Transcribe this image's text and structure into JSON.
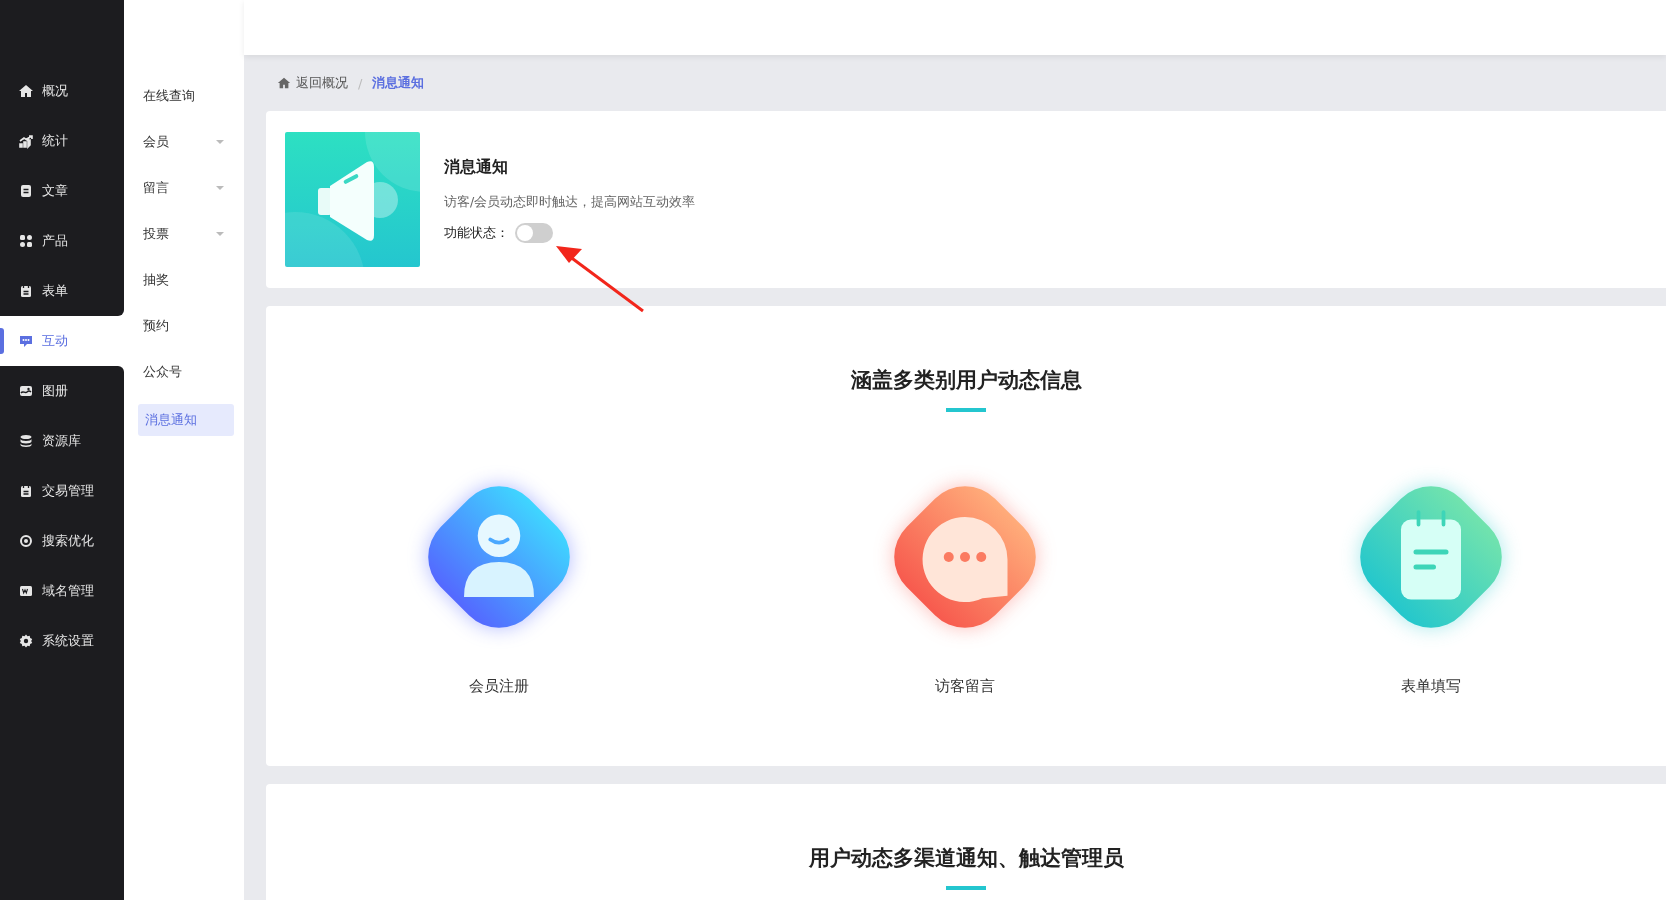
{
  "sidebar": {
    "items": [
      {
        "label": "概况",
        "selected": false
      },
      {
        "label": "统计",
        "selected": false
      },
      {
        "label": "文章",
        "selected": false
      },
      {
        "label": "产品",
        "selected": false
      },
      {
        "label": "表单",
        "selected": false
      },
      {
        "label": "互动",
        "selected": true
      },
      {
        "label": "图册",
        "selected": false
      },
      {
        "label": "资源库",
        "selected": false
      },
      {
        "label": "交易管理",
        "selected": false
      },
      {
        "label": "搜索优化",
        "selected": false
      },
      {
        "label": "域名管理",
        "selected": false
      },
      {
        "label": "系统设置",
        "selected": false
      }
    ]
  },
  "submenu": {
    "items": [
      {
        "label": "在线查询",
        "expandable": false,
        "selected": false
      },
      {
        "label": "会员",
        "expandable": true,
        "selected": false
      },
      {
        "label": "留言",
        "expandable": true,
        "selected": false
      },
      {
        "label": "投票",
        "expandable": true,
        "selected": false
      },
      {
        "label": "抽奖",
        "expandable": false,
        "selected": false
      },
      {
        "label": "预约",
        "expandable": false,
        "selected": false
      },
      {
        "label": "公众号",
        "expandable": false,
        "selected": false
      },
      {
        "label": "消息通知",
        "expandable": false,
        "selected": true
      }
    ]
  },
  "breadcrumb": {
    "back": "返回概况",
    "separator": "/",
    "current": "消息通知"
  },
  "feature_card": {
    "title": "消息通知",
    "description": "访客/会员动态即时触达，提高网站互动效率",
    "status_label": "功能状态：",
    "toggle": {
      "on": false
    }
  },
  "sections": [
    {
      "title": "涵盖多类别用户动态信息",
      "features": [
        {
          "label": "会员注册",
          "kind": "member"
        },
        {
          "label": "访客留言",
          "kind": "message"
        },
        {
          "label": "表单填写",
          "kind": "form"
        }
      ]
    },
    {
      "title": "用户动态多渠道通知、触达管理员"
    }
  ]
}
